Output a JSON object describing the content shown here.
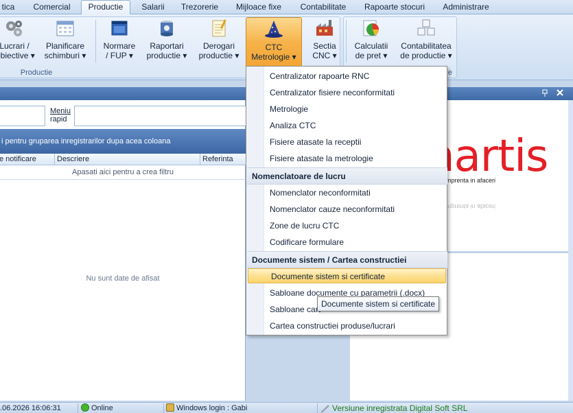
{
  "tabs": [
    {
      "label": "tica",
      "active": false
    },
    {
      "label": "Comercial",
      "active": false
    },
    {
      "label": "Productie",
      "active": true
    },
    {
      "label": "Salarii",
      "active": false
    },
    {
      "label": "Trezorerie",
      "active": false
    },
    {
      "label": "Mijloace fixe",
      "active": false
    },
    {
      "label": "Contabilitate",
      "active": false
    },
    {
      "label": "Rapoarte stocuri",
      "active": false
    },
    {
      "label": "Administrare",
      "active": false
    }
  ],
  "ribbon": {
    "group_label": "Productie",
    "group_label_right": "e",
    "buttons": [
      {
        "line1": "Lucrari /",
        "line2": "obiective ▾"
      },
      {
        "line1": "Planificare",
        "line2": "schimburi ▾"
      },
      {
        "line1": "Normare",
        "line2": "/ FUP ▾"
      },
      {
        "line1": "Raportari",
        "line2": "productie ▾"
      },
      {
        "line1": "Derogari",
        "line2": "productie ▾"
      },
      {
        "line1": "CTC",
        "line2": "Metrologie ▾"
      },
      {
        "line1": "Sectia",
        "line2": "CNC ▾"
      },
      {
        "line1": "Calculatii",
        "line2": "de pret ▾"
      },
      {
        "line1": "Contabilitatea",
        "line2": "de productie ▾"
      }
    ]
  },
  "left_panel": {
    "meniu_line1": "Meniu",
    "meniu_line2": "rapid",
    "group_hint": "i pentru gruparea inregistrarilor dupa acea coloana",
    "columns": [
      "e notificare",
      "Descriere",
      "Referinta"
    ],
    "filter_hint": "Apasati aici pentru a  crea filtru",
    "empty_message": "Nu sunt date de afisat"
  },
  "right_panel": {
    "logo_text": "nartis",
    "logo_tagline": "mprenta in afaceri",
    "pin_icon": "pin-icon",
    "close_icon": "close-icon"
  },
  "menu": {
    "items_top": [
      "Centralizator rapoarte RNC",
      "Centralizator fisiere neconformitati",
      "Metrologie",
      "Analiza CTC",
      "Fisiere atasate la receptii",
      "Fisiere atasate la metrologie"
    ],
    "header1": "Nomenclatoare de lucru",
    "items_mid": [
      "Nomenclator neconformitati",
      "Nomenclator cauze neconformitati",
      "Zone de lucru CTC",
      "Codificare formulare"
    ],
    "header2": "Documente sistem / Cartea constructiei",
    "items_bottom": [
      "Documente sistem si certificate",
      "Sabloane documente cu parametrii (.docx)",
      "Sabloane cart",
      "Cartea constructiei produse/lucrari"
    ],
    "highlighted": "Documente sistem si certificate"
  },
  "tooltip": "Documente sistem si certificate",
  "status": {
    "datetime": ".06.2026 16:06:31",
    "online": "Online",
    "windows_login": "Windows login : Gabi",
    "version": "Versiune inregistrata Digital Soft SRL"
  },
  "colors": {
    "accent": "#3e6aa6",
    "highlight": "#fbd46c",
    "logo_red": "#e41f26",
    "version_green": "#1c7a1c",
    "online_green": "#44b82a"
  }
}
